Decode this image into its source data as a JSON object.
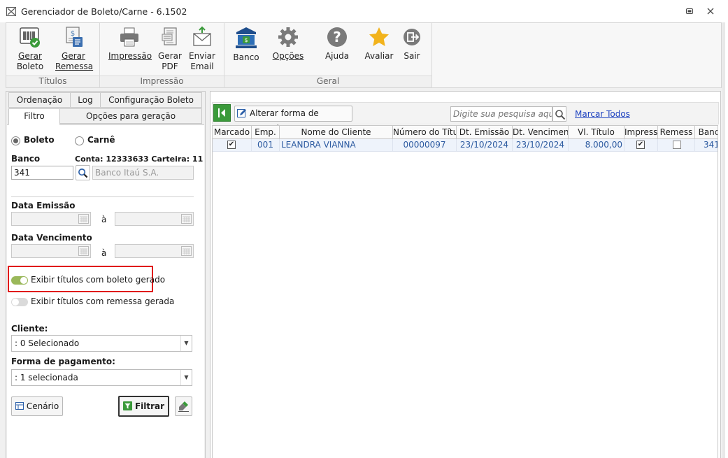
{
  "window": {
    "title": "Gerenciador de Boleto/Carne - 6.1502"
  },
  "ribbon": {
    "groups": {
      "titulos": "Títulos",
      "impressao": "Impressão",
      "geral": "Geral"
    },
    "buttons": {
      "gerar_boleto": [
        "Gerar",
        "Boleto"
      ],
      "gerar_remessa": [
        "Gerar",
        "Remessa"
      ],
      "impressao": "Impressão",
      "gerar_pdf": [
        "Gerar",
        "PDF"
      ],
      "enviar_email": [
        "Enviar",
        "Email"
      ],
      "banco": "Banco",
      "opcoes": "Opções",
      "ajuda": "Ajuda",
      "avaliar": "Avaliar",
      "sair": "Sair"
    }
  },
  "left_tabs": {
    "row1": [
      "Ordenação",
      "Log",
      "Configuração Boleto"
    ],
    "row2": [
      "Filtro",
      "Opções para geração"
    ]
  },
  "filter": {
    "radio_boleto": "Boleto",
    "radio_carne": "Carnê",
    "banco_label": "Banco",
    "conta_info": "Conta: 12333633 Carteira: 11",
    "banco_code": "341",
    "banco_name": "Banco Itaú S.A.",
    "data_emissao_label": "Data Emissão",
    "data_vencimento_label": "Data Vencimento",
    "range_sep": "à",
    "toggle_boleto": "Exibir títulos com boleto gerado",
    "toggle_remessa": "Exibir títulos com remessa gerada",
    "cliente_label": "Cliente:",
    "cliente_value": ": 0 Selecionado",
    "forma_label": "Forma de pagamento:",
    "forma_value": ": 1 selecionada",
    "cenario_button": "Cenário",
    "filtrar_button": "Filtrar"
  },
  "toolbar": {
    "alterar_button": "Alterar forma de pagamento",
    "search_placeholder": "Digite sua pesquisa aqui...",
    "marcar_todos": "Marcar Todos"
  },
  "grid": {
    "headers": [
      "Marcado",
      "Emp.",
      "Nome do Cliente",
      "Número do Títu",
      "Dt. Emissão",
      "Dt. Vencimen",
      "Vl. Título",
      "Impress",
      "Remess",
      "Banc"
    ],
    "rows": [
      {
        "marcado": true,
        "emp": "001",
        "cliente": "LEANDRA VIANNA",
        "numero": "00000097",
        "emissao": "23/10/2024",
        "vencimento": "23/10/2024",
        "valor": "8.000,00",
        "impresso": true,
        "remessa": false,
        "banco": "341"
      }
    ]
  },
  "colors": {
    "accent_green": "#3a9a3a",
    "highlight_red": "#e01b1b",
    "toggle_on": "#9ab85a",
    "link_blue": "#1a3fbf",
    "cell_text": "#2c5aa0"
  }
}
